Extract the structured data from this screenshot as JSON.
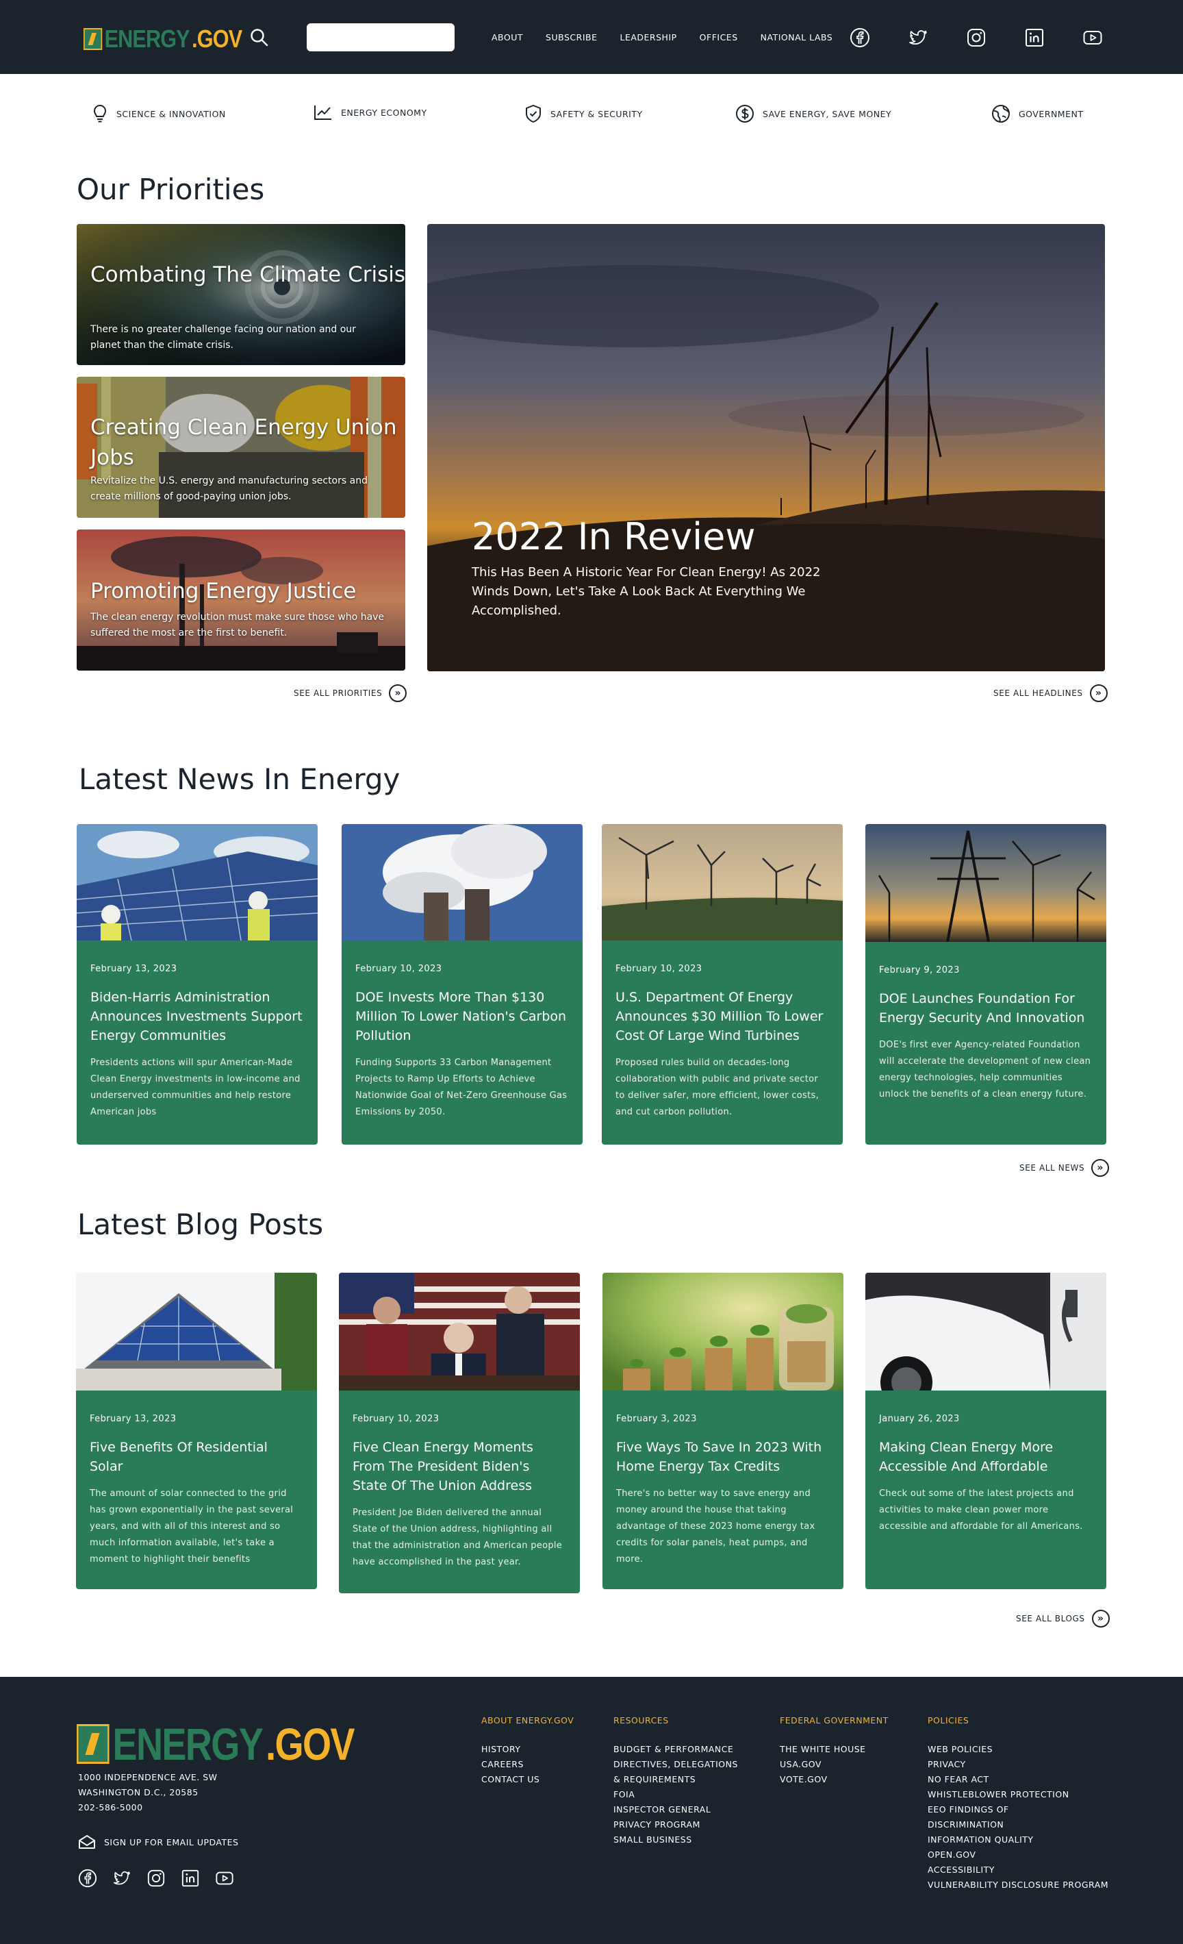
{
  "header": {
    "logo_prefix": "ENERGY",
    "logo_suffix": ".GOV",
    "search_placeholder": "",
    "nav": [
      "ABOUT",
      "SUBSCRIBE",
      "LEADERSHIP",
      "OFFICES",
      "NATIONAL LABS"
    ],
    "social_icons": [
      "facebook-icon",
      "twitter-icon",
      "instagram-icon",
      "linkedin-icon",
      "youtube-icon"
    ]
  },
  "categories": [
    {
      "label": "SCIENCE & INNOVATION",
      "icon": "lightbulb-icon"
    },
    {
      "label": "ENERGY ECONOMY",
      "icon": "chart-line-icon"
    },
    {
      "label": "SAFETY & SECURITY",
      "icon": "shield-check-icon"
    },
    {
      "label": "SAVE ENERGY, SAVE MONEY",
      "icon": "dollar-circle-icon"
    },
    {
      "label": "GOVERNMENT",
      "icon": "globe-icon"
    }
  ],
  "priorities": {
    "heading": "Our Priorities",
    "cards": [
      {
        "title": "Combating The Climate Crisis",
        "desc": "There is no greater challenge facing our nation and our planet than the climate crisis."
      },
      {
        "title": "Creating Clean Energy Union Jobs",
        "desc": "Revitalize the U.S. energy and manufacturing sectors and create millions of good-paying union jobs."
      },
      {
        "title": "Promoting Energy Justice",
        "desc": "The clean energy revolution must make sure those who have suffered the most are the first to benefit."
      }
    ],
    "hero": {
      "title": "2022 In Review",
      "desc": "This Has Been A Historic Year For Clean Energy! As 2022 Winds Down, Let's Take A Look Back At Everything We Accomplished."
    },
    "see_all_priorities": "SEE ALL PRIORITIES",
    "see_all_headlines": "SEE ALL HEADLINES"
  },
  "news": {
    "heading": "Latest News In Energy",
    "cards": [
      {
        "date": "February 13, 2023",
        "title": "Biden-Harris Administration Announces Investments Support Energy Communities",
        "desc": "Presidents actions will spur American-Made Clean Energy investments in low-income and underserved communities and help restore American jobs"
      },
      {
        "date": "February 10, 2023",
        "title": "DOE Invests More Than $130 Million To Lower Nation's Carbon Pollution",
        "desc": "Funding Supports 33 Carbon Management Projects to Ramp Up Efforts to Achieve Nationwide Goal of Net-Zero Greenhouse Gas Emissions by 2050."
      },
      {
        "date": "February 10, 2023",
        "title": "U.S. Department Of Energy Announces $30 Million To Lower Cost Of Large Wind Turbines",
        "desc": "Proposed rules build on decades-long collaboration with public and private sector to deliver safer, more efficient, lower costs, and cut carbon pollution."
      },
      {
        "date": "February 9, 2023",
        "title": "DOE Launches Foundation For Energy Security And Innovation",
        "desc": "DOE's first ever Agency-related Foundation will accelerate the development of new clean energy technologies, help communities unlock the benefits of a clean energy future."
      }
    ],
    "see_all": "SEE ALL NEWS"
  },
  "blogs": {
    "heading": "Latest Blog Posts",
    "cards": [
      {
        "date": "February 13, 2023",
        "title": "Five Benefits Of Residential Solar",
        "desc": "The amount of solar connected to the grid has grown exponentially in the past several years, and with all of this interest and so much information available, let's take a moment to highlight their benefits"
      },
      {
        "date": "February 10, 2023",
        "title": "Five Clean Energy Moments From The President Biden's State Of The Union Address",
        "desc": "President Joe Biden delivered the annual State of the Union address, highlighting all that the administration and American people have accomplished in the past year."
      },
      {
        "date": "February 3, 2023",
        "title": "Five Ways To Save In 2023 With Home Energy Tax Credits",
        "desc": "There's no better way to save energy and money around the house that taking advantage of these 2023 home energy tax credits for solar panels, heat pumps, and more."
      },
      {
        "date": "January 26, 2023",
        "title": "Making Clean Energy More Accessible And Affordable",
        "desc": "Check out some of the latest projects and activities to make clean power more accessible and affordable for all Americans."
      }
    ],
    "see_all": "SEE ALL BLOGS"
  },
  "footer": {
    "logo_prefix": "ENERGY",
    "logo_suffix": ".GOV",
    "address": [
      "1000 INDEPENDENCE AVE. SW",
      "WASHINGTON D.C., 20585",
      "202-586-5000"
    ],
    "email_signup": "SIGN UP FOR EMAIL UPDATES",
    "columns": [
      {
        "heading": "ABOUT ENERGY.GOV",
        "links": [
          "HISTORY",
          "CAREERS",
          "CONTACT US"
        ]
      },
      {
        "heading": "RESOURCES",
        "links": [
          "BUDGET & PERFORMANCE",
          "DIRECTIVES, DELEGATIONS",
          "& REQUIREMENTS",
          "FOIA",
          "INSPECTOR GENERAL",
          "PRIVACY PROGRAM",
          "SMALL BUSINESS"
        ]
      },
      {
        "heading": "FEDERAL GOVERNMENT",
        "links": [
          "THE WHITE HOUSE",
          "USA.GOV",
          "VOTE.GOV"
        ]
      },
      {
        "heading": "POLICIES",
        "links": [
          "WEB POLICIES",
          "PRIVACY",
          "NO FEAR ACT",
          "WHISTLEBLOWER PROTECTION",
          "EEO FINDINGS OF",
          "DISCRIMINATION",
          "INFORMATION QUALITY",
          "OPEN.GOV",
          "ACCESSIBILITY",
          "VULNERABILITY DISCLOSURE PROGRAM"
        ]
      }
    ]
  },
  "colors": {
    "dark": "#1b232d",
    "green": "#2a7b57",
    "gold": "#f3b229"
  }
}
